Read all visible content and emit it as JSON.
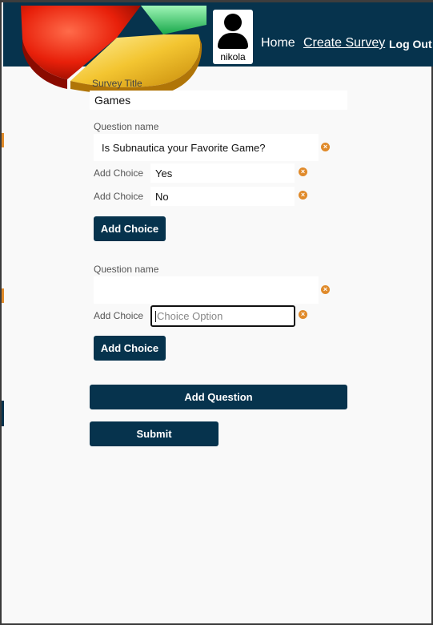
{
  "header": {
    "user_name": "nikola",
    "nav_home": "Home",
    "nav_create": "Create Survey",
    "nav_logout": "Log Out"
  },
  "survey": {
    "title_label": "Survey Title",
    "title_value": "Games",
    "questions": [
      {
        "name_label": "Question name",
        "name_value": "Is Subnautica your Favorite Game?",
        "choices": [
          {
            "label": "Add Choice",
            "value": "Yes"
          },
          {
            "label": "Add Choice",
            "value": "No"
          }
        ],
        "add_choice_label": "Add Choice"
      },
      {
        "name_label": "Question name",
        "name_value": "",
        "choices": [
          {
            "label": "Add Choice",
            "placeholder": "Choice Option"
          }
        ],
        "add_choice_label": "Add Choice"
      }
    ],
    "add_question_label": "Add Question",
    "submit_label": "Submit"
  },
  "colors": {
    "header_bg": "#06334d",
    "button_bg": "#06334d",
    "remove_icon": "#e08a2a"
  }
}
